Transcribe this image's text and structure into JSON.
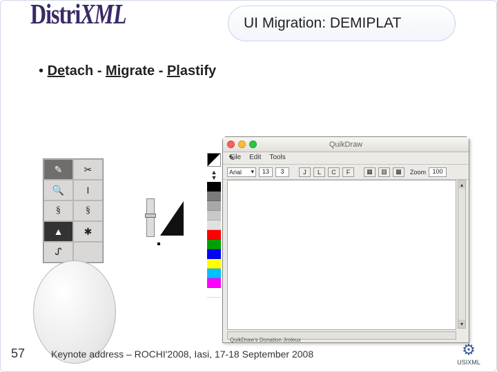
{
  "header": {
    "title": "UI Migration: DEMIPLAT",
    "logo_a": "Distri",
    "logo_b": "XML"
  },
  "bullet": {
    "prefix": "•  ",
    "de": "De",
    "tach": "tach - ",
    "mi": "Mi",
    "grate": "grate - ",
    "pl": "Pl",
    "astify": "astify"
  },
  "footer": {
    "page": "57",
    "text": "Keynote address – ROCHI'2008, Iasi, 17-18 September 2008",
    "logo_small": "USIXML"
  },
  "tools": [
    "✎",
    "✂",
    "🔍",
    "I",
    "§",
    "§",
    "▲",
    "✱",
    "ᔑ",
    ""
  ],
  "swatches": [
    "#000000",
    "#7a7a7a",
    "#a8a8a8",
    "#c9c9c9",
    "#e0e0e0",
    "#ff0000",
    "#00a000",
    "#0000ff",
    "#ffff00",
    "#00c0ff",
    "#ff00ff",
    "#ffffff"
  ],
  "app": {
    "window_title": "QuikDraw",
    "menus": [
      "File",
      "Edit",
      "Tools"
    ],
    "font_name": "Arial",
    "font_size": "13",
    "line_w": "3",
    "style_buttons": [
      "J",
      "L",
      "C",
      "F"
    ],
    "pattern_buttons": [
      "▦",
      "▨",
      "▩"
    ],
    "zoom_label": "Zoom",
    "zoom_value": "100"
  },
  "canvas_status": "QuikDraw's Donation Jroleux"
}
